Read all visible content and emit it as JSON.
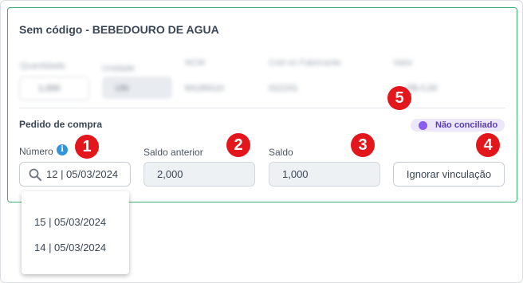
{
  "card": {
    "title": "Sem código - BEBEDOURO DE AGUA"
  },
  "blurred_fields": {
    "labels": [
      "Quantidade",
      "Unidade",
      "NCM",
      "Cod no Fabricante",
      "Valor"
    ],
    "values": [
      "1,000",
      "UN",
      "84185010",
      "022151",
      "R$ 0,00"
    ]
  },
  "purchase_order": {
    "section_title": "Pedido de compra",
    "status_badge": "Não conciliado",
    "number_label": "Número",
    "number_value": "12 | 05/03/2024",
    "previous_balance_label": "Saldo anterior",
    "previous_balance_value": "2,000",
    "balance_label": "Saldo",
    "balance_value": "1,000",
    "ignore_link_button": "Ignorar vinculação",
    "dropdown_options": [
      "15 | 05/03/2024",
      "14 | 05/03/2024"
    ]
  },
  "annotations": [
    "1",
    "2",
    "3",
    "4",
    "5"
  ],
  "colors": {
    "card_border": "#3fae75",
    "badge_bg": "#ece7fa",
    "badge_dot": "#8a5cf0",
    "marker": "#e3161c",
    "info_icon": "#2f95dc"
  },
  "icons": {
    "search": "search-icon",
    "info": "info-icon"
  }
}
